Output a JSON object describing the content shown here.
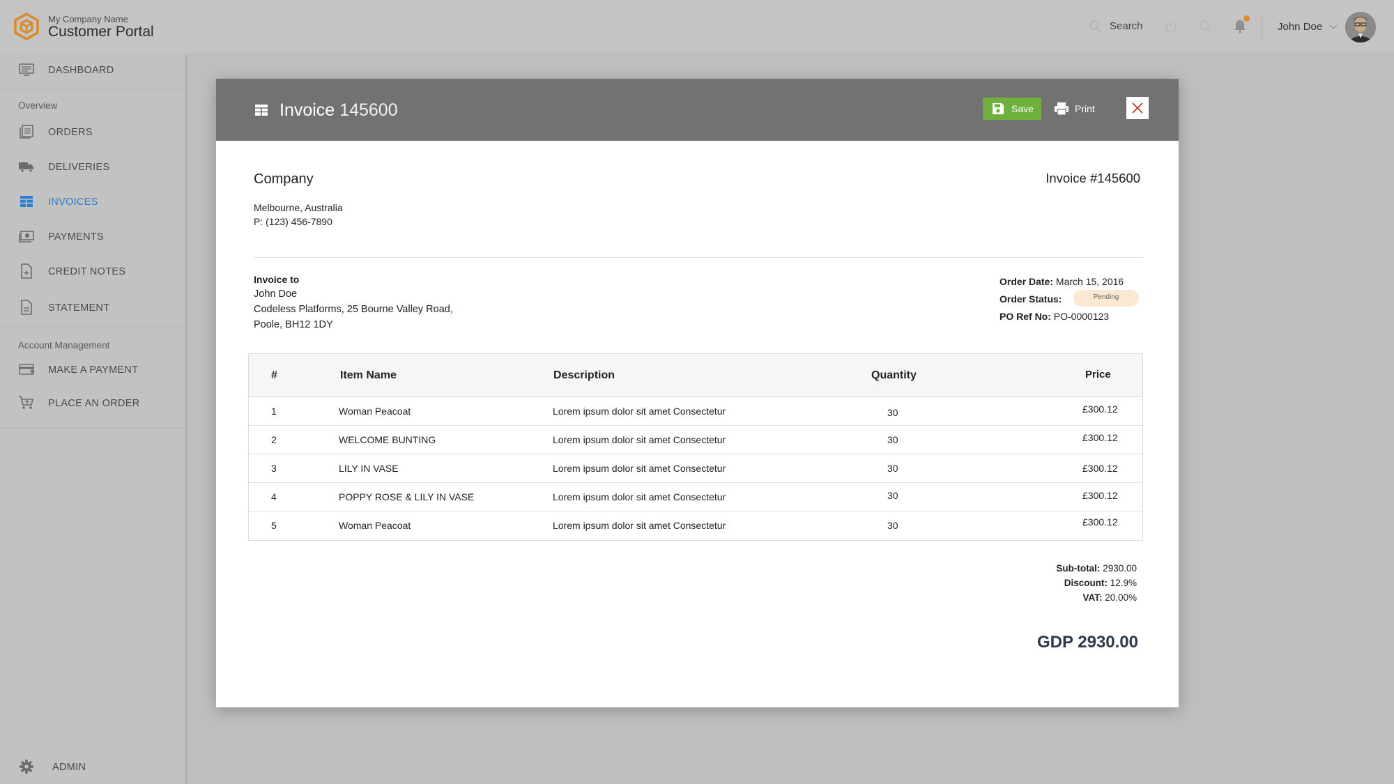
{
  "header": {
    "company_small": "My Company Name",
    "portal_title": "Customer Portal",
    "search_label": "Search",
    "user_name": "John Doe",
    "notification_color": "#e08d2c"
  },
  "sidebar": {
    "dashboard": "DASHBOARD",
    "section_overview": "Overview",
    "items_overview": [
      {
        "label": "ORDERS",
        "icon": "list-icon"
      },
      {
        "label": "DELIVERIES",
        "icon": "truck-icon"
      },
      {
        "label": "INVOICES",
        "icon": "table-icon",
        "active": true
      },
      {
        "label": "PAYMENTS",
        "icon": "money-icon"
      },
      {
        "label": "CREDIT NOTES",
        "icon": "note-add-icon"
      },
      {
        "label": "STATEMENT",
        "icon": "document-icon"
      }
    ],
    "section_account": "Account Management",
    "items_account": [
      {
        "label": "MAKE A PAYMENT",
        "icon": "card-icon"
      },
      {
        "label": "PLACE AN ORDER",
        "icon": "cart-icon"
      }
    ],
    "admin": "ADMIN",
    "active_color": "#2f7fd0"
  },
  "modal": {
    "title": "Invoice",
    "title_number": "145600",
    "save_label": "Save",
    "print_label": "Print",
    "save_color": "#6fb03d",
    "company": {
      "name": "Company",
      "address": "Melbourne, Australia",
      "phone": "P: (123) 456-7890"
    },
    "invoice_ref": "Invoice #145600",
    "bill_to": {
      "heading": "Invoice to",
      "name": "John Doe",
      "address1": "Codeless Platforms, 25 Bourne Valley Road,",
      "address2": "Poole, BH12 1DY"
    },
    "meta": {
      "order_date_label": "Order Date:",
      "order_date": "March 15, 2016",
      "status_label": "Order Status:",
      "status": "Pending",
      "po_label": "PO Ref No:",
      "po": "PO-0000123"
    },
    "table": {
      "headers": [
        "#",
        "Item Name",
        "Description",
        "Quantity",
        "Price"
      ],
      "rows": [
        [
          "1",
          "Woman Peacoat",
          "Lorem ipsum dolor sit amet Consectetur",
          "30",
          "£300.12"
        ],
        [
          "2",
          "WELCOME BUNTING",
          "Lorem ipsum dolor sit amet Consectetur",
          "30",
          "£300.12"
        ],
        [
          "3",
          "LILY IN VASE",
          "Lorem ipsum dolor sit amet Consectetur",
          "30",
          "£300.12"
        ],
        [
          "4",
          "POPPY ROSE & LILY IN VASE",
          "Lorem ipsum dolor sit amet Consectetur",
          "30",
          "£300.12"
        ],
        [
          "5",
          "Woman Peacoat",
          "Lorem ipsum dolor sit amet Consectetur",
          "30",
          "£300.12"
        ]
      ]
    },
    "totals": {
      "subtotal_label": "Sub-total:",
      "subtotal": "2930.00",
      "discount_label": "Discount:",
      "discount": "12.9%",
      "vat_label": "VAT:",
      "vat": "20.00%",
      "grand_total": "GDP 2930.00"
    }
  }
}
